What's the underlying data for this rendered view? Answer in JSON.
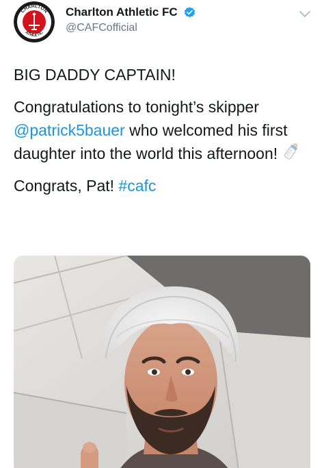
{
  "author": {
    "display_name": "Charlton Athletic FC",
    "handle": "@CAFCofficial",
    "avatar_text_top": "CHARLTON",
    "avatar_text_bottom": "ATHLETIC",
    "verified": true
  },
  "tweet": {
    "line1": "BIG DADDY CAPTAIN!",
    "p2_before": "Congratulations to tonight’s skipper ",
    "p2_mention": "@patrick5bauer",
    "p2_after": " who welcomed his first daughter into the world this afternoon!",
    "p2_emoji": "baby-bottle-icon",
    "p3_before": "Congrats, Pat! ",
    "p3_hashtag": "#cafc"
  },
  "colors": {
    "link": "#1b95e0",
    "text": "#14171a",
    "muted": "#657786",
    "verified": "#1da1f2",
    "avatar_red": "#d4121c"
  }
}
